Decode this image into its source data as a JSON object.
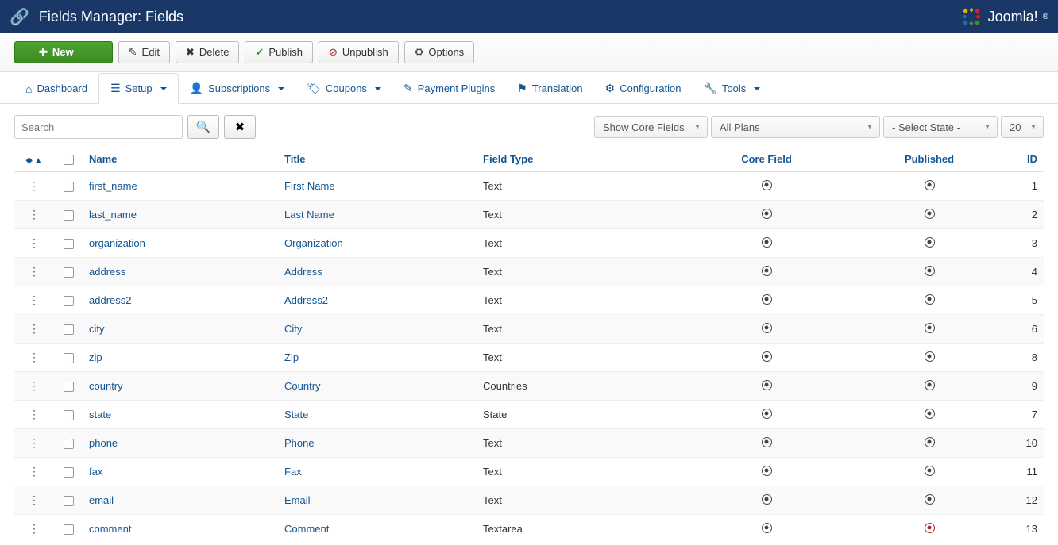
{
  "header": {
    "title": "Fields Manager: Fields",
    "brand": "Joomla!"
  },
  "toolbar": {
    "new_label": "New",
    "edit_label": "Edit",
    "delete_label": "Delete",
    "publish_label": "Publish",
    "unpublish_label": "Unpublish",
    "options_label": "Options"
  },
  "nav": {
    "dashboard": "Dashboard",
    "setup": "Setup",
    "subscriptions": "Subscriptions",
    "coupons": "Coupons",
    "payment_plugins": "Payment Plugins",
    "translation": "Translation",
    "configuration": "Configuration",
    "tools": "Tools"
  },
  "filters": {
    "search_placeholder": "Search",
    "show_core": "Show Core Fields",
    "all_plans": "All Plans",
    "select_state": "- Select State -",
    "limit": "20"
  },
  "columns": {
    "name": "Name",
    "title": "Title",
    "field_type": "Field Type",
    "core_field": "Core Field",
    "published": "Published",
    "id": "ID"
  },
  "rows": [
    {
      "name": "first_name",
      "title": "First Name",
      "type": "Text",
      "core": true,
      "published": true,
      "id": "1"
    },
    {
      "name": "last_name",
      "title": "Last Name",
      "type": "Text",
      "core": true,
      "published": true,
      "id": "2"
    },
    {
      "name": "organization",
      "title": "Organization",
      "type": "Text",
      "core": true,
      "published": true,
      "id": "3"
    },
    {
      "name": "address",
      "title": "Address",
      "type": "Text",
      "core": true,
      "published": true,
      "id": "4"
    },
    {
      "name": "address2",
      "title": "Address2",
      "type": "Text",
      "core": true,
      "published": true,
      "id": "5"
    },
    {
      "name": "city",
      "title": "City",
      "type": "Text",
      "core": true,
      "published": true,
      "id": "6"
    },
    {
      "name": "zip",
      "title": "Zip",
      "type": "Text",
      "core": true,
      "published": true,
      "id": "8"
    },
    {
      "name": "country",
      "title": "Country",
      "type": "Countries",
      "core": true,
      "published": true,
      "id": "9"
    },
    {
      "name": "state",
      "title": "State",
      "type": "State",
      "core": true,
      "published": true,
      "id": "7"
    },
    {
      "name": "phone",
      "title": "Phone",
      "type": "Text",
      "core": true,
      "published": true,
      "id": "10"
    },
    {
      "name": "fax",
      "title": "Fax",
      "type": "Text",
      "core": true,
      "published": true,
      "id": "11"
    },
    {
      "name": "email",
      "title": "Email",
      "type": "Text",
      "core": true,
      "published": true,
      "id": "12"
    },
    {
      "name": "comment",
      "title": "Comment",
      "type": "Textarea",
      "core": true,
      "published": false,
      "id": "13"
    }
  ]
}
